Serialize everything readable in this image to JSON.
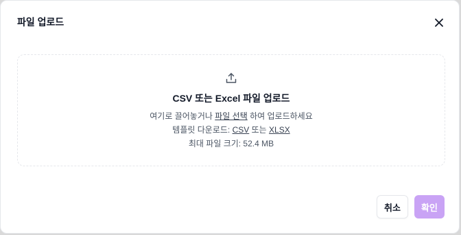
{
  "dialog": {
    "title": "파일 업로드",
    "close_icon": "close-icon"
  },
  "dropzone": {
    "icon": "upload-icon",
    "heading": "CSV 또는 Excel 파일 업로드",
    "instruction_prefix": "여기로 끌어놓거나 ",
    "select_link": "파일 선택",
    "instruction_suffix": " 하여 업로드하세요",
    "template_prefix": "템플릿 다운로드: ",
    "template_csv": "CSV",
    "template_or": " 또는 ",
    "template_xlsx": "XLSX",
    "max_size": "최대 파일 크기: 52.4 MB"
  },
  "footer": {
    "cancel_label": "취소",
    "confirm_label": "확인"
  },
  "colors": {
    "confirm_bg": "#c9a3f5",
    "text": "#111827",
    "muted": "#4b5563"
  }
}
